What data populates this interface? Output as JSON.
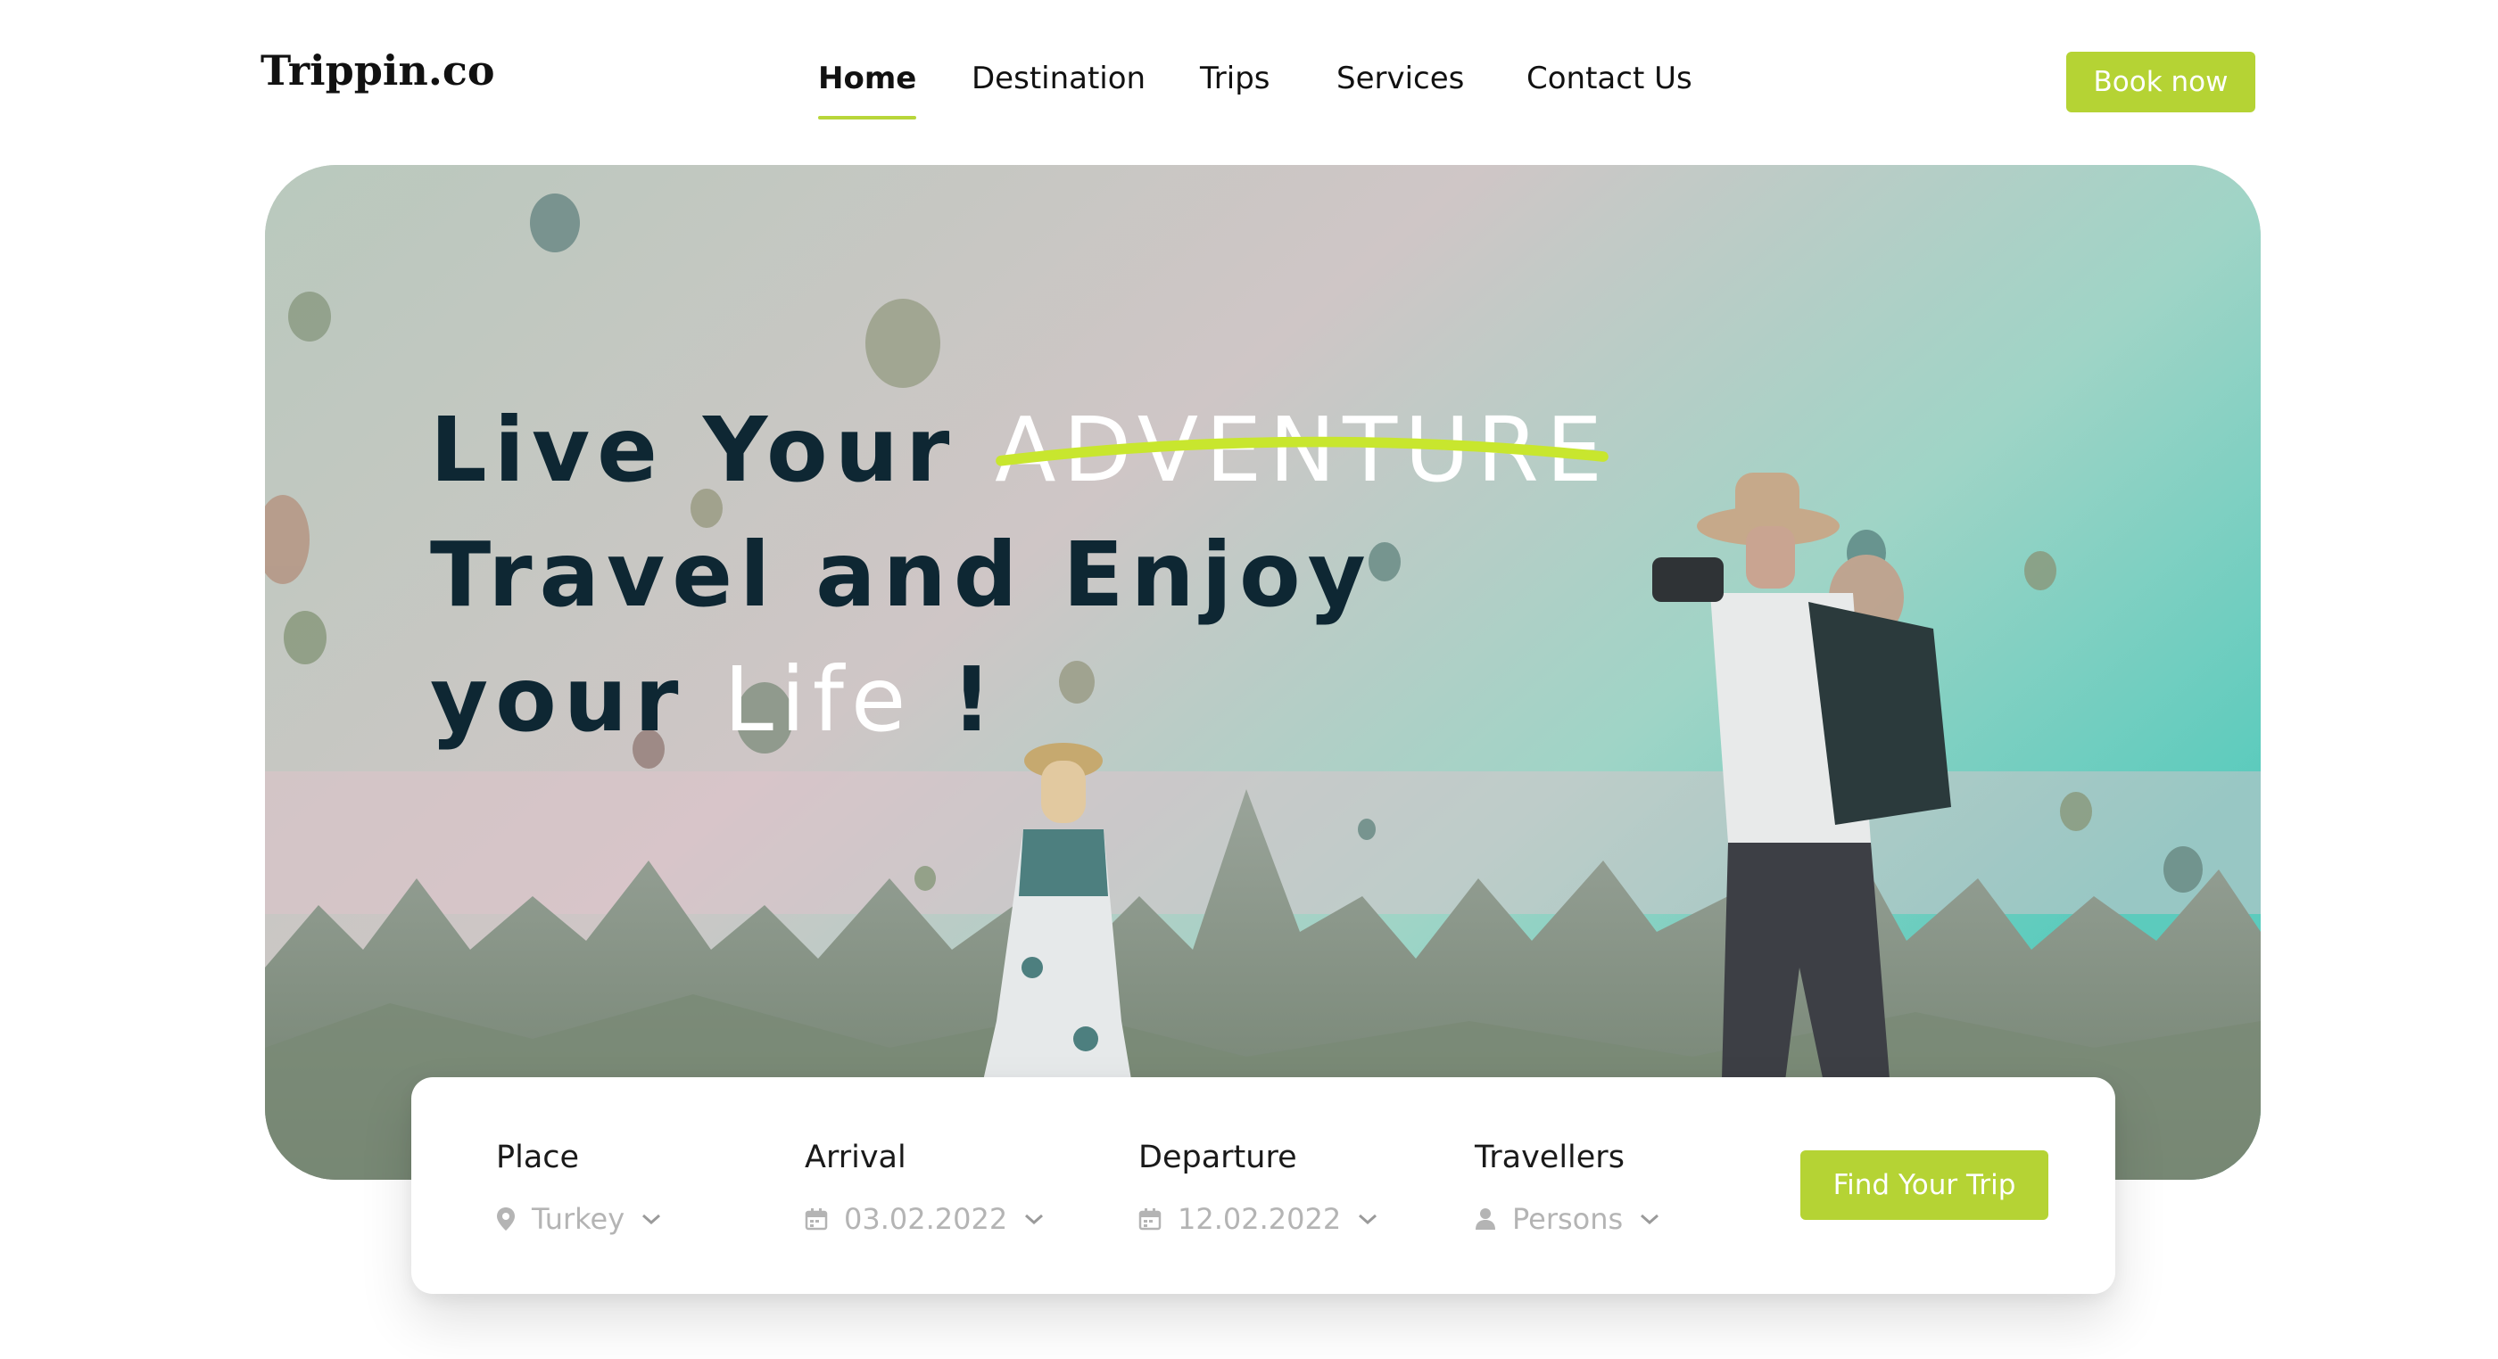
{
  "brand": {
    "logo": "Trippin.co"
  },
  "nav": {
    "items": [
      {
        "label": "Home",
        "active": true
      },
      {
        "label": "Destination",
        "active": false
      },
      {
        "label": "Trips",
        "active": false
      },
      {
        "label": "Services",
        "active": false
      },
      {
        "label": "Contact Us",
        "active": false
      }
    ],
    "cta_label": "Book now"
  },
  "hero": {
    "line1_prefix": "Live Your ",
    "line1_highlight": "ADVENTURE",
    "line2": "Travel and Enjoy",
    "line3_prefix": "your ",
    "line3_highlight": "Life",
    "line3_suffix": " !"
  },
  "search": {
    "fields": [
      {
        "label": "Place",
        "value": "Turkey",
        "icon": "location-pin-icon"
      },
      {
        "label": "Arrival",
        "value": "03.02.2022",
        "icon": "calendar-icon"
      },
      {
        "label": "Departure",
        "value": "12.02.2022",
        "icon": "calendar-icon"
      },
      {
        "label": "Travellers",
        "value": "Persons",
        "icon": "person-icon"
      }
    ],
    "submit_label": "Find Your Trip"
  },
  "colors": {
    "accent": "#b5d334",
    "headline": "#0e2733",
    "placeholder": "#b4b4b4"
  }
}
